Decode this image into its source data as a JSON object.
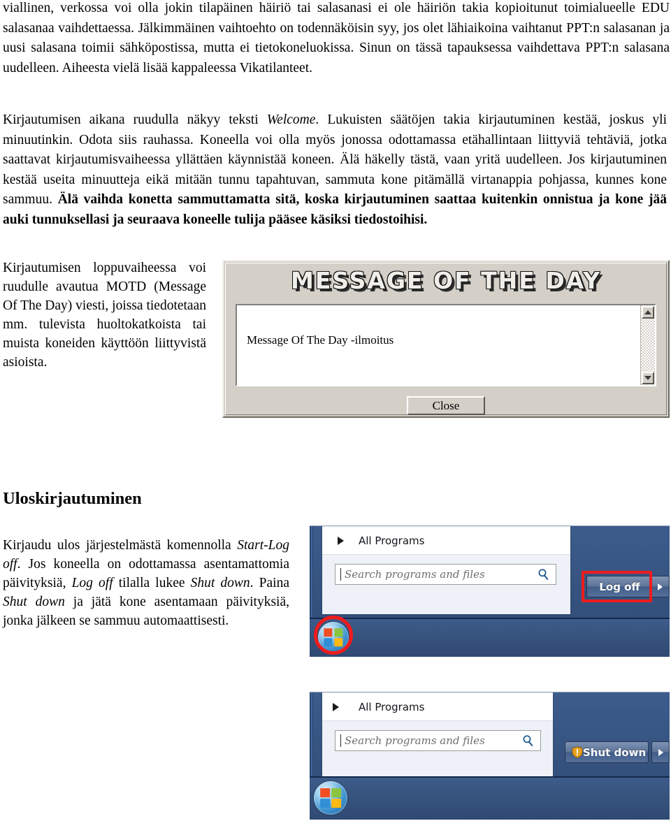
{
  "document": {
    "paragraph_1_html": "viallinen, verkossa voi olla jokin tilapäinen häiriö tai salasanasi ei ole häiriön takia kopioitunut toimialueelle EDU salasanaa vaihdettaessa. Jälkimmäinen vaihtoehto on todennäköisin syy, jos olet lähiaikoina vaihtanut PPT:n salasanan ja uusi salasana toimii sähköpostissa, mutta ei tietokoneluokissa. Sinun on tässä tapauksessa vaihdettava PPT:n salasana uudelleen. Aiheesta vielä lisää kappaleessa Vikatilanteet.",
    "paragraph_2_html": "Kirjautumisen aikana ruudulla näkyy teksti Welcome. Lukuisten säätöjen takia kirjautuminen kestää, joskus yli minuutinkin. Odota siis rauhassa. Koneella voi olla myös jonossa odottamassa etähallintaan liittyviä tehtäviä, jotka saattavat kirjautumisvaiheessa yllättäen käynnistää koneen. Älä häkelly tästä, vaan yritä uudelleen. Jos kirjautuminen kestää useita minuutteja eikä mitään tunnu tapahtuvan, sammuta kone pitämällä virtanappia pohjassa, kunnes kone sammuu. Älä vaihda konetta sammuttamatta sitä, koska kirjautuminen saattaa kuitenkin onnistua ja kone jää auki tunnuksellasi ja seuraava koneelle tulija pääsee käsiksi tiedostoihisi.",
    "paragraph_3_html": "Kirjautumisen loppuvaiheessa voi ruudulle avautua MOTD (Message Of The Day) viesti, joissa tiedotetaan mm. tulevista huoltokatkoista tai muista koneiden käyttöön liittyvistä asioista.",
    "heading_logout": "Uloskirjautuminen",
    "paragraph_4_html": "Kirjaudu ulos järjestelmästä komennolla Start-Log off. Jos koneella on odottamassa asentamattomia päivityksiä, Log off tilalla lukee Shut down. Paina Shut down ja jätä kone asentamaan päivityksiä, jonka jälkeen se sammuu automaattisesti."
  },
  "motd_dialog": {
    "title": "MESSAGE OF THE DAY",
    "message_text": "Message Of The Day -ilmoitus",
    "close_button": "Close",
    "scroll_up_icon": "triangle-up-icon",
    "scroll_down_icon": "triangle-down-icon"
  },
  "startmenu_logoff": {
    "all_programs_label": "All Programs",
    "all_programs_icon": "chevron-right-icon",
    "search_placeholder": "Search programs and files",
    "search_value": "",
    "search_icon": "magnifier-icon",
    "power_button_label": "Log off",
    "power_more_icon": "chevron-right-icon",
    "start_orb_icon": "windows-orb-icon",
    "annotation_color": "#ee1c1c"
  },
  "startmenu_shutdown": {
    "all_programs_label": "All Programs",
    "all_programs_icon": "chevron-right-icon",
    "search_placeholder": "Search programs and files",
    "search_value": "",
    "search_icon": "magnifier-icon",
    "power_button_label": "Shut down",
    "power_button_icon": "uac-shield-icon",
    "power_more_icon": "chevron-right-icon",
    "start_orb_icon": "windows-orb-icon"
  },
  "theme": {
    "dialog_face": "#d4d0c8",
    "start_menu_blue": "#35527e",
    "annotation_red": "#ee1c1c"
  }
}
